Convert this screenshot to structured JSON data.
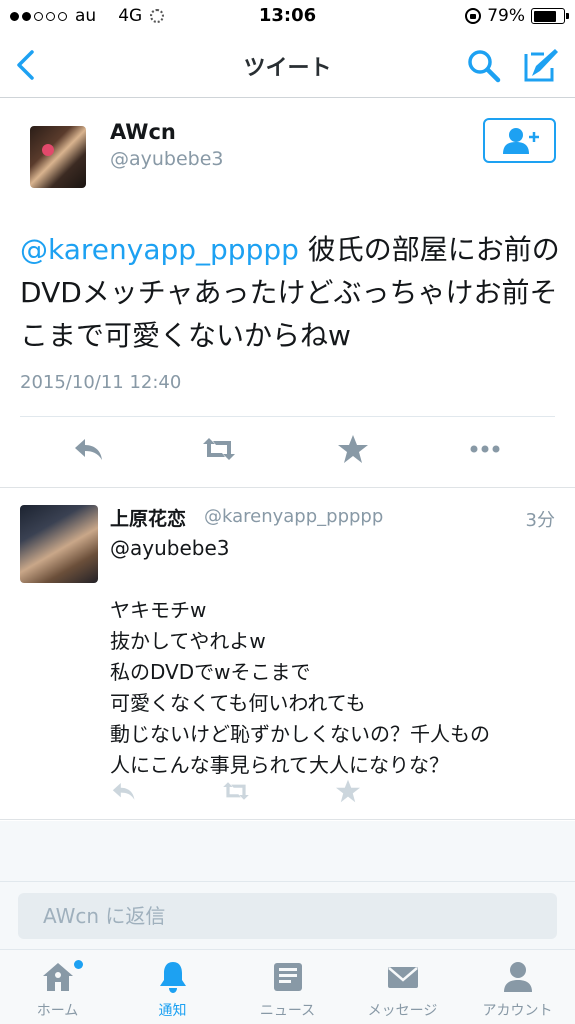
{
  "status_bar": {
    "carrier": "au",
    "network": "4G",
    "time": "13:06",
    "battery": "79%",
    "battery_level": 0.79,
    "signal_bars_filled": 2,
    "signal_bars_total": 5
  },
  "nav": {
    "title": "ツイート"
  },
  "tweet": {
    "name": "AWcn",
    "handle": "@ayubebe3",
    "mention": "@karenyapp_ppppp",
    "text": " 彼氏の部屋にお前のDVDメッチャあったけどぶっちゃけお前そこまで可愛くないからねw",
    "date": "2015/10/11 12:40"
  },
  "reply": {
    "name": "上原花恋",
    "handle": "@karenyapp_ppppp",
    "time": "3分",
    "text": "@ayubebe3\n\nヤキモチw\n抜かしてやれよw\n私のDVDでwそこまで\n可愛くなくても何いわれても\n動じないけど恥ずかしくないの？千人もの\n人にこんな事見られて大人になりな？"
  },
  "reply_bar": {
    "placeholder": "AWcn に返信"
  },
  "tabs": [
    {
      "label": "ホーム",
      "icon": "home-icon",
      "active": false
    },
    {
      "label": "通知",
      "icon": "bell-icon",
      "active": true
    },
    {
      "label": "ニュース",
      "icon": "news-icon",
      "active": false
    },
    {
      "label": "メッセージ",
      "icon": "envelope-icon",
      "active": false
    },
    {
      "label": "アカウント",
      "icon": "person-icon",
      "active": false
    }
  ],
  "colors": {
    "accent": "#1da1f2",
    "icon_gray": "#8899a6",
    "text": "#14171a"
  }
}
